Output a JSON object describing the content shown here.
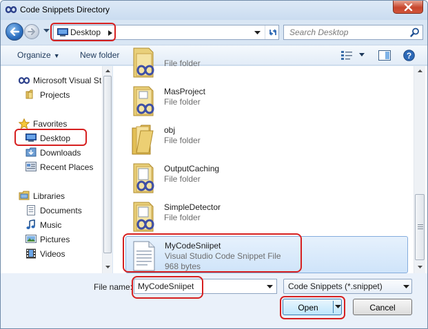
{
  "window": {
    "title": "Code Snippets Directory",
    "annotation_color": "#d61f1f"
  },
  "address": {
    "location": "Desktop",
    "search_placeholder": "Search Desktop"
  },
  "toolbar": {
    "organize": "Organize",
    "new_folder": "New folder"
  },
  "nav": {
    "items": [
      {
        "label": "Microsoft Visual St",
        "icon": "visual-studio-icon"
      },
      {
        "label": "Projects",
        "icon": "folder-icon"
      },
      {
        "label": "Favorites",
        "icon": "star-icon"
      },
      {
        "label": "Desktop",
        "icon": "desktop-icon",
        "selected": true
      },
      {
        "label": "Downloads",
        "icon": "downloads-icon"
      },
      {
        "label": "Recent Places",
        "icon": "recent-places-icon"
      },
      {
        "label": "Libraries",
        "icon": "libraries-icon"
      },
      {
        "label": "Documents",
        "icon": "documents-icon"
      },
      {
        "label": "Music",
        "icon": "music-icon"
      },
      {
        "label": "Pictures",
        "icon": "pictures-icon"
      },
      {
        "label": "Videos",
        "icon": "videos-icon"
      }
    ]
  },
  "files": [
    {
      "name": "",
      "type": "File folder"
    },
    {
      "name": "MasProject",
      "type": "File folder"
    },
    {
      "name": "obj",
      "type": "File folder"
    },
    {
      "name": "OutputCaching",
      "type": "File folder"
    },
    {
      "name": "SimpleDetector",
      "type": "File folder"
    },
    {
      "name": "MyCodeSniipet",
      "type": "Visual Studio Code Snippet File",
      "size": "968 bytes",
      "selected": true
    }
  ],
  "bottom": {
    "file_name_label": "File name:",
    "file_name_value": "MyCodeSniipet",
    "filter": "Code Snippets (*.snippet)",
    "open": "Open",
    "cancel": "Cancel"
  }
}
